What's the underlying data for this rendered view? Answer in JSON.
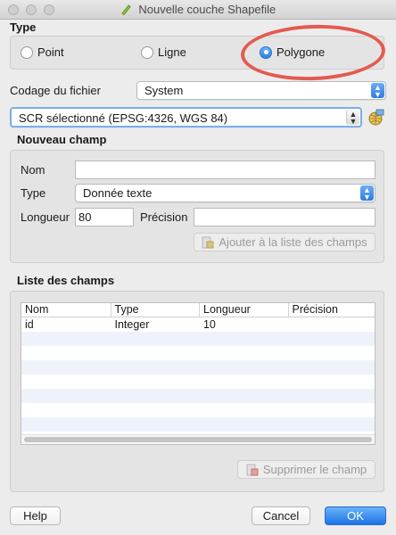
{
  "window": {
    "title": "Nouvelle couche Shapefile"
  },
  "type_group": {
    "title": "Type",
    "options": [
      {
        "label": "Point",
        "checked": false
      },
      {
        "label": "Ligne",
        "checked": false
      },
      {
        "label": "Polygone",
        "checked": true
      }
    ]
  },
  "encoding": {
    "label": "Codage du fichier",
    "value": "System"
  },
  "crs": {
    "value": "SCR sélectionné (EPSG:4326, WGS 84)"
  },
  "new_field": {
    "title": "Nouveau champ",
    "name_label": "Nom",
    "name_value": "",
    "type_label": "Type",
    "type_value": "Donnée texte",
    "length_label": "Longueur",
    "length_value": "80",
    "precision_label": "Précision",
    "precision_value": "",
    "add_button": "Ajouter à la liste des champs"
  },
  "field_list": {
    "title": "Liste des champs",
    "columns": [
      "Nom",
      "Type",
      "Longueur",
      "Précision"
    ],
    "rows": [
      [
        "id",
        "Integer",
        "10",
        ""
      ]
    ],
    "remove_button": "Supprimer le champ"
  },
  "footer": {
    "help": "Help",
    "cancel": "Cancel",
    "ok": "OK"
  },
  "colors": {
    "accent": "#2f7be0",
    "highlight": "#e45a4f"
  }
}
